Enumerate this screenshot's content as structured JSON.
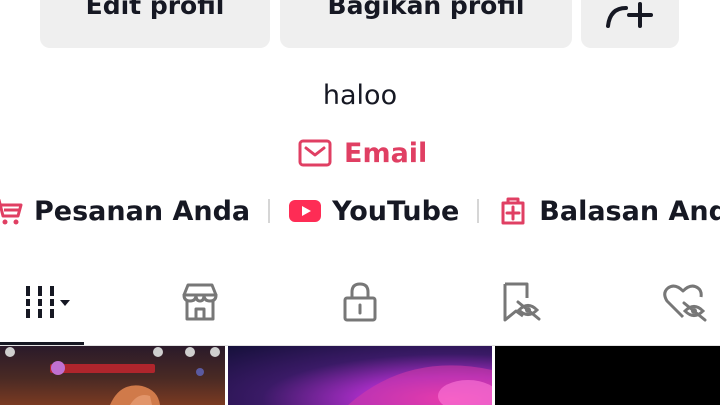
{
  "buttons": {
    "edit_label": "Edit profil",
    "share_label": "Bagikan profil"
  },
  "bio": {
    "text": "haloo"
  },
  "email": {
    "label": "Email",
    "color": "#e03f63"
  },
  "links": [
    {
      "label": "Pesanan Anda",
      "icon": "cart-icon"
    },
    {
      "label": "YouTube",
      "icon": "youtube-icon"
    },
    {
      "label": "Balasan Anda",
      "icon": "reply-box-icon"
    }
  ],
  "tabs": [
    {
      "icon": "grid-icon",
      "selected": true
    },
    {
      "icon": "shop-icon",
      "selected": false
    },
    {
      "icon": "lock-icon",
      "selected": false
    },
    {
      "icon": "bookmark-hidden-icon",
      "selected": false
    },
    {
      "icon": "liked-hidden-icon",
      "selected": false
    }
  ],
  "accent": "#e03f63",
  "youtube_red": "#fe2c55"
}
